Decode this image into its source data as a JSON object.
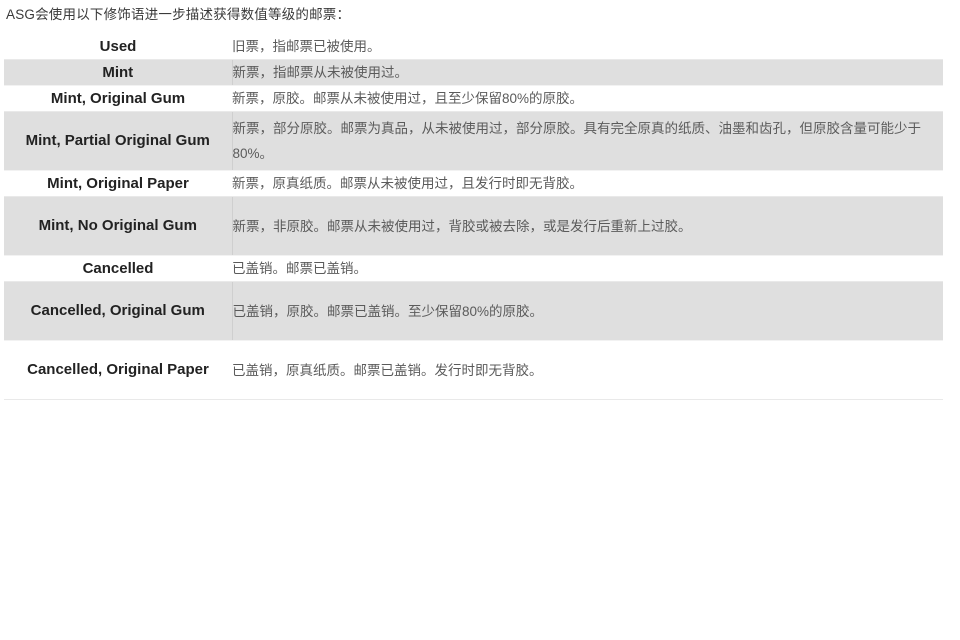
{
  "page": {
    "intro": "ASG会使用以下修饰语进一步描述获得数值等级的邮票：",
    "background_color": "#ffffff",
    "row_alt_color": "#dfdfdf",
    "term_text_color": "#222222",
    "description_text_color": "#5b5b5b",
    "divider_color": "#dcdcdc"
  },
  "table": {
    "rows": [
      {
        "term": "Used",
        "description": "旧票，指邮票已被使用。"
      },
      {
        "term": "Mint",
        "description": "新票，指邮票从未被使用过。"
      },
      {
        "term": "Mint, Original Gum",
        "description": "新票，原胶。邮票从未被使用过，且至少保留80%的原胶。"
      },
      {
        "term": "Mint, Partial Original Gum",
        "description": "新票，部分原胶。邮票为真品，从未被使用过，部分原胶。具有完全原真的纸质、油墨和齿孔，但原胶含量可能少于80%。"
      },
      {
        "term": "Mint, Original Paper",
        "description": "新票，原真纸质。邮票从未被使用过，且发行时即无背胶。"
      },
      {
        "term": "Mint, No Original Gum",
        "description": "新票，非原胶。邮票从未被使用过，背胶或被去除，或是发行后重新上过胶。"
      },
      {
        "term": "Cancelled",
        "description": "已盖销。邮票已盖销。"
      },
      {
        "term": "Cancelled, Original Gum",
        "description": "已盖销，原胶。邮票已盖销。至少保留80%的原胶。"
      },
      {
        "term": "Cancelled, Original Paper",
        "description": "已盖销，原真纸质。邮票已盖销。发行时即无背胶。"
      }
    ]
  }
}
